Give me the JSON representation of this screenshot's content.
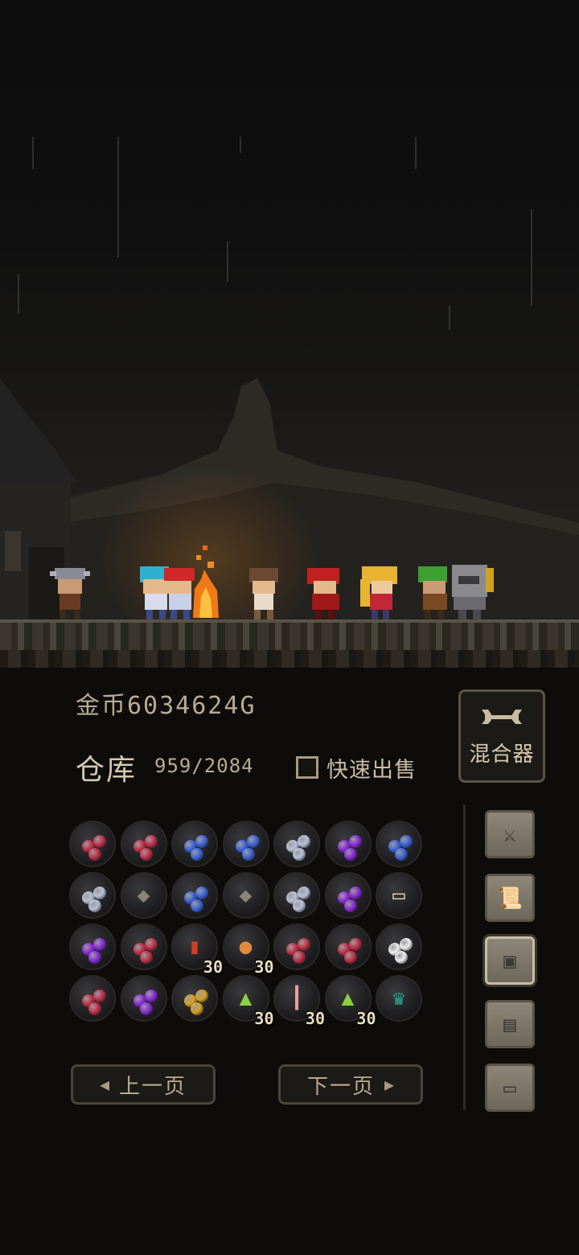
{
  "gold": {
    "label": "金币",
    "amount": "6034624G"
  },
  "warehouse": {
    "title": "仓库",
    "count": "959/2084"
  },
  "quick_sell": {
    "label": "快速出售",
    "checked": false
  },
  "mixer": {
    "label": "混合器",
    "icon": "wrench-icon"
  },
  "side_buttons": [
    {
      "name": "equipment-tab",
      "icon": "swords-icon",
      "active": false
    },
    {
      "name": "scroll-tab",
      "icon": "scroll-icon",
      "active": false
    },
    {
      "name": "warehouse-tab",
      "icon": "box-icon",
      "active": true
    },
    {
      "name": "documents-tab",
      "icon": "documents-icon",
      "active": false
    },
    {
      "name": "computer-tab",
      "icon": "computer-icon",
      "active": false
    }
  ],
  "inventory": [
    [
      {
        "item": "red-gem-cluster"
      },
      {
        "item": "red-gem-cluster"
      },
      {
        "item": "blue-gem-cluster"
      },
      {
        "item": "blue-gem-cluster"
      },
      {
        "item": "silver-gem-cluster"
      },
      {
        "item": "purple-gem-cluster"
      },
      {
        "item": "blue-gem-cluster"
      }
    ],
    [
      {
        "item": "silver-gem-cluster"
      },
      {
        "item": "stone-block"
      },
      {
        "item": "blue-gem-cluster"
      },
      {
        "item": "stone-block"
      },
      {
        "item": "silver-gem-cluster"
      },
      {
        "item": "purple-gem-cluster"
      },
      {
        "item": "map-scroll"
      }
    ],
    [
      {
        "item": "purple-gem-cluster"
      },
      {
        "item": "red-gem-cluster"
      },
      {
        "item": "red-potion",
        "count": "30"
      },
      {
        "item": "bread-loaf",
        "count": "30"
      },
      {
        "item": "red-gem-cluster"
      },
      {
        "item": "red-gem-cluster"
      },
      {
        "item": "white-gem-cluster"
      }
    ],
    [
      {
        "item": "red-gem-cluster"
      },
      {
        "item": "purple-gem-cluster"
      },
      {
        "item": "gold-gem-cluster"
      },
      {
        "item": "green-flame",
        "count": "30"
      },
      {
        "item": "candle",
        "count": "30"
      },
      {
        "item": "green-flame",
        "count": "30"
      },
      {
        "item": "teal-crown"
      }
    ]
  ],
  "pagination": {
    "prev_label": "上一页",
    "next_label": "下一页"
  },
  "colors": {
    "red": "#c0304a",
    "blue": "#3d64d8",
    "silver": "#b8c0d8",
    "purple": "#8a2bd8",
    "gold": "#d9a020",
    "white": "#eeeeee",
    "teal": "#2aa890"
  }
}
